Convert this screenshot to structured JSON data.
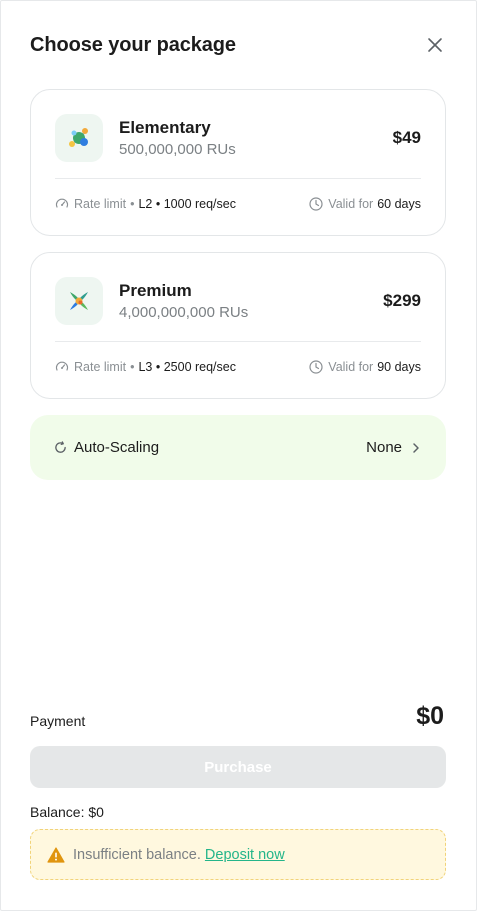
{
  "header": {
    "title": "Choose your package",
    "close_icon": "close-icon"
  },
  "packages": [
    {
      "name": "Elementary",
      "rus": "500,000,000 RUs",
      "price": "$49",
      "rate_label": "Rate limit",
      "rate_value": "L2 • 1000 req/sec",
      "valid_label": "Valid for",
      "valid_value": "60 days",
      "icon": "molecule-icon"
    },
    {
      "name": "Premium",
      "rus": "4,000,000,000 RUs",
      "price": "$299",
      "rate_label": "Rate limit",
      "rate_value": "L3 • 2500 req/sec",
      "valid_label": "Valid for",
      "valid_value": "90 days",
      "icon": "premium-flower-icon"
    }
  ],
  "autoscaling": {
    "label": "Auto-Scaling",
    "value": "None",
    "icon": "refresh-icon",
    "chevron": "chevron-right-icon"
  },
  "payment": {
    "label": "Payment",
    "amount": "$0"
  },
  "purchase": {
    "label": "Purchase",
    "disabled": true
  },
  "balance": {
    "text": "Balance: $0"
  },
  "warning": {
    "text": "Insufficient balance.",
    "link": "Deposit now",
    "icon": "warning-icon"
  },
  "colors": {
    "accent_link": "#24b58a",
    "autoscale_bg": "#f1fcea",
    "warning_bg": "#fff8df",
    "warning_icon": "#e0950f",
    "disabled_button": "#e5e7e8"
  }
}
